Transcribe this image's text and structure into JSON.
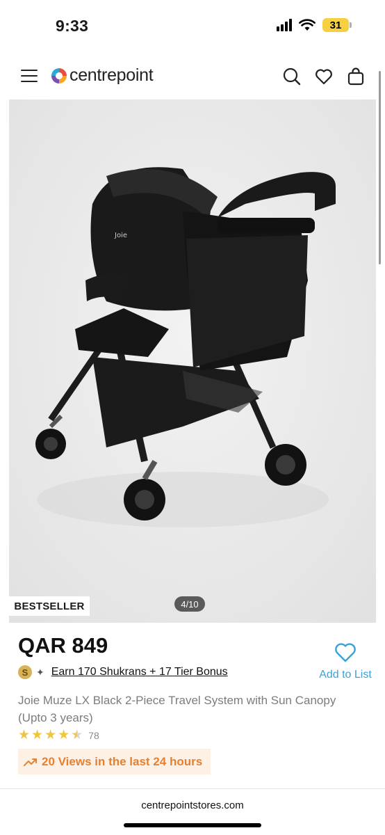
{
  "status_bar": {
    "time": "9:33",
    "battery": "31"
  },
  "header": {
    "brand": "centrepoint",
    "icons": [
      "menu-icon",
      "search-icon",
      "heart-icon",
      "shopping-bag-icon"
    ]
  },
  "gallery": {
    "badge": "BESTSELLER",
    "counter": "4/10"
  },
  "product": {
    "price": "QAR 849",
    "shukran_text": "Earn 170 Shukrans +  17 Tier Bonus",
    "shukran_coin": "S",
    "add_to_list": "Add to List",
    "name": "Joie Muze LX Black 2-Piece Travel System with Sun Canopy (Upto 3 years)",
    "rating": 4.5,
    "rating_count": "78",
    "views": "20 Views in the last 24 hours"
  },
  "browser": {
    "url": "centrepointstores.com"
  },
  "colors": {
    "accent": "#3aa2d6",
    "star": "#f0c542",
    "views": "#e6802e",
    "views_bg": "#fdf1e6"
  }
}
